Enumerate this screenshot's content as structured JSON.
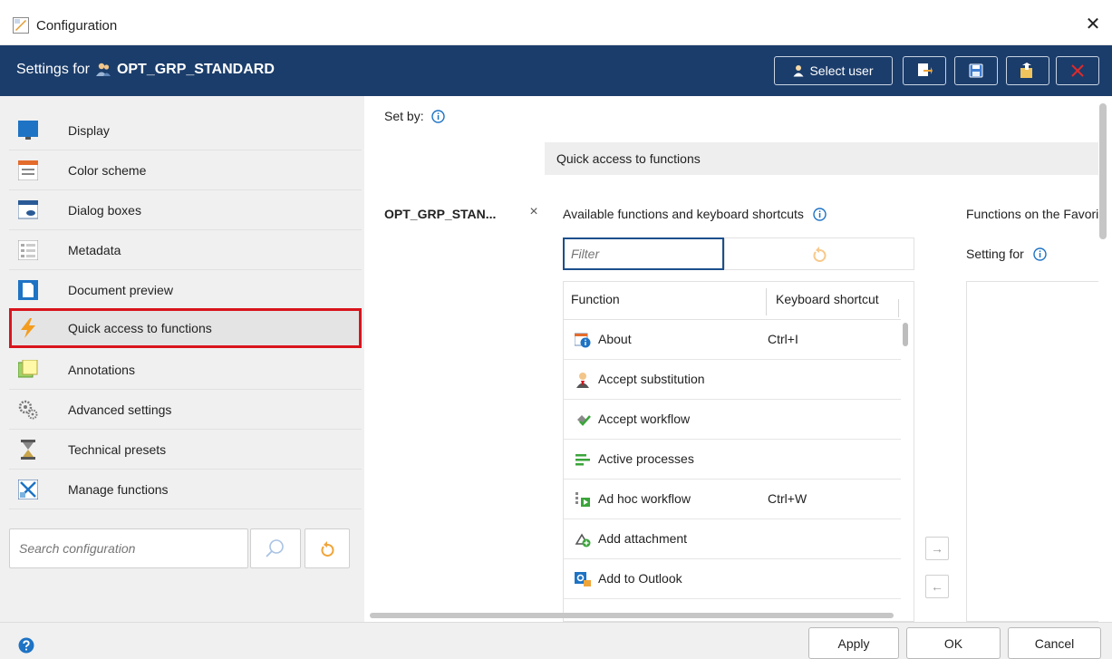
{
  "window": {
    "title": "Configuration",
    "close_symbol": "✕"
  },
  "header": {
    "settings_prefix": "Settings for",
    "group_name": "OPT_GRP_STANDARD",
    "select_user_label": "Select user",
    "bg_color": "#1b3d6b"
  },
  "sidebar": {
    "items": [
      {
        "label": "Display",
        "icon": "monitor-icon"
      },
      {
        "label": "Color scheme",
        "icon": "color-scheme-icon"
      },
      {
        "label": "Dialog boxes",
        "icon": "dialog-box-icon"
      },
      {
        "label": "Metadata",
        "icon": "metadata-icon"
      },
      {
        "label": "Document preview",
        "icon": "document-icon"
      },
      {
        "label": "Quick access to functions",
        "icon": "lightning-icon",
        "active": true
      },
      {
        "label": "Annotations",
        "icon": "annotation-icon"
      },
      {
        "label": "Advanced settings",
        "icon": "gears-icon"
      },
      {
        "label": "Technical presets",
        "icon": "hourglass-icon"
      },
      {
        "label": "Manage functions",
        "icon": "manage-functions-icon"
      }
    ],
    "search_placeholder": "Search configuration"
  },
  "main": {
    "set_by_label": "Set by:",
    "section_title": "Quick access to functions",
    "user_group": "OPT_GRP_STAN...",
    "remove_symbol": "×",
    "available_title": "Available functions and keyboard shortcuts",
    "favorites_title": "Functions on the Favorites",
    "setting_for_label": "Setting for",
    "filter_placeholder": "Filter",
    "table": {
      "col_function": "Function",
      "col_shortcut": "Keyboard shortcut",
      "rows": [
        {
          "name": "About",
          "shortcut": "Ctrl+I",
          "icon": "info-icon"
        },
        {
          "name": "Accept substitution",
          "shortcut": "",
          "icon": "substitution-icon"
        },
        {
          "name": "Accept workflow",
          "shortcut": "",
          "icon": "workflow-icon"
        },
        {
          "name": "Active processes",
          "shortcut": "",
          "icon": "processes-icon"
        },
        {
          "name": "Ad hoc workflow",
          "shortcut": "Ctrl+W",
          "icon": "adhoc-workflow-icon"
        },
        {
          "name": "Add attachment",
          "shortcut": "",
          "icon": "attachment-icon"
        },
        {
          "name": "Add to Outlook",
          "shortcut": "",
          "icon": "outlook-icon"
        }
      ]
    },
    "arrow_right": "→",
    "arrow_left": "←"
  },
  "footer": {
    "apply": "Apply",
    "ok": "OK",
    "cancel": "Cancel"
  }
}
